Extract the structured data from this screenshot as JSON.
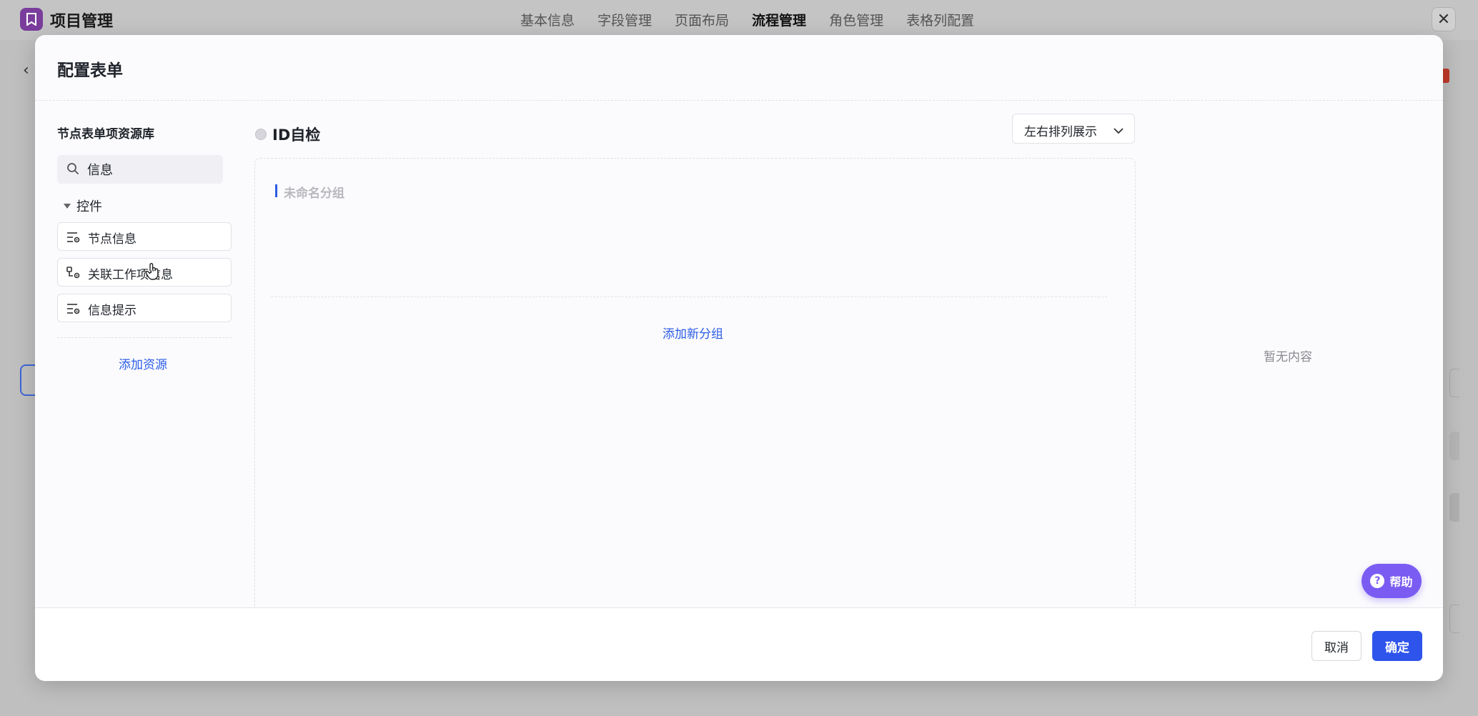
{
  "app": {
    "title": "项目管理",
    "nav": [
      "基本信息",
      "字段管理",
      "页面布局",
      "流程管理",
      "角色管理",
      "表格列配置"
    ],
    "active_nav": "流程管理"
  },
  "modal": {
    "title": "配置表单",
    "resource_panel": {
      "title": "节点表单项资源库",
      "search": {
        "value": "信息"
      },
      "group": {
        "label": "控件",
        "expanded": true
      },
      "items": [
        {
          "label": "节点信息",
          "icon": "list-settings-icon"
        },
        {
          "label": "关联工作项信息",
          "icon": "flow-settings-icon"
        },
        {
          "label": "信息提示",
          "icon": "list-settings-icon"
        }
      ],
      "add_label": "添加资源"
    },
    "form": {
      "name": "ID自检",
      "layout_select": "左右排列展示",
      "section_title": "未命名分组",
      "add_group_label": "添加新分组"
    },
    "properties": {
      "empty_text": "暂无内容"
    },
    "help_label": "帮助",
    "footer": {
      "cancel_label": "取消",
      "ok_label": "确定"
    }
  },
  "colors": {
    "accent": "#2e54eb",
    "link": "#2b5ce6",
    "help": "#7b5cf2",
    "logo": "#7a3d9c"
  }
}
